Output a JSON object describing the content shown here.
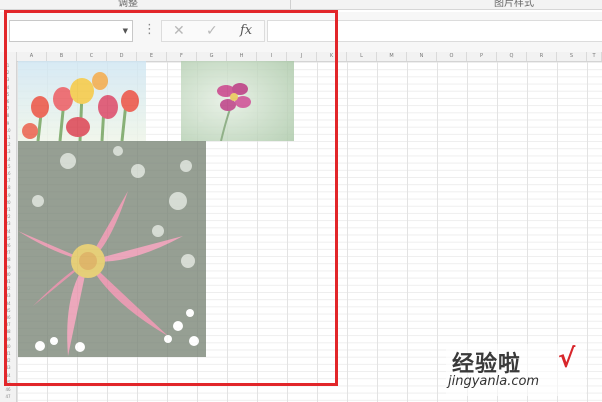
{
  "ribbon": {
    "groups": [
      {
        "label": "调整"
      },
      {
        "label": "图片样式"
      }
    ]
  },
  "formula_bar": {
    "name_box_value": "",
    "more_icon": "⋮",
    "cancel_icon": "✕",
    "confirm_icon": "✓",
    "fx_label": "fx",
    "formula_value": ""
  },
  "sheet": {
    "columns": [
      "A",
      "B",
      "C",
      "D",
      "E",
      "F",
      "G",
      "H",
      "I",
      "J",
      "K",
      "L",
      "M",
      "N",
      "O",
      "P",
      "Q",
      "R",
      "S",
      "T"
    ],
    "rows": [
      "1",
      "2",
      "3",
      "4",
      "5",
      "6",
      "7",
      "8",
      "9",
      "10",
      "11",
      "12",
      "13",
      "14",
      "15",
      "16",
      "17",
      "18",
      "19",
      "20",
      "21",
      "22",
      "23",
      "24",
      "25",
      "26",
      "27",
      "28",
      "29",
      "30",
      "31",
      "32",
      "33",
      "34",
      "35",
      "36",
      "37",
      "38",
      "39",
      "40",
      "41",
      "42",
      "43",
      "44",
      "45",
      "46",
      "47"
    ]
  },
  "watermark": {
    "title": "经验啦",
    "check": "√",
    "url": "jingyanla.com"
  },
  "colors": {
    "highlight": "#e2262a",
    "watermark_check": "#d8262b"
  }
}
